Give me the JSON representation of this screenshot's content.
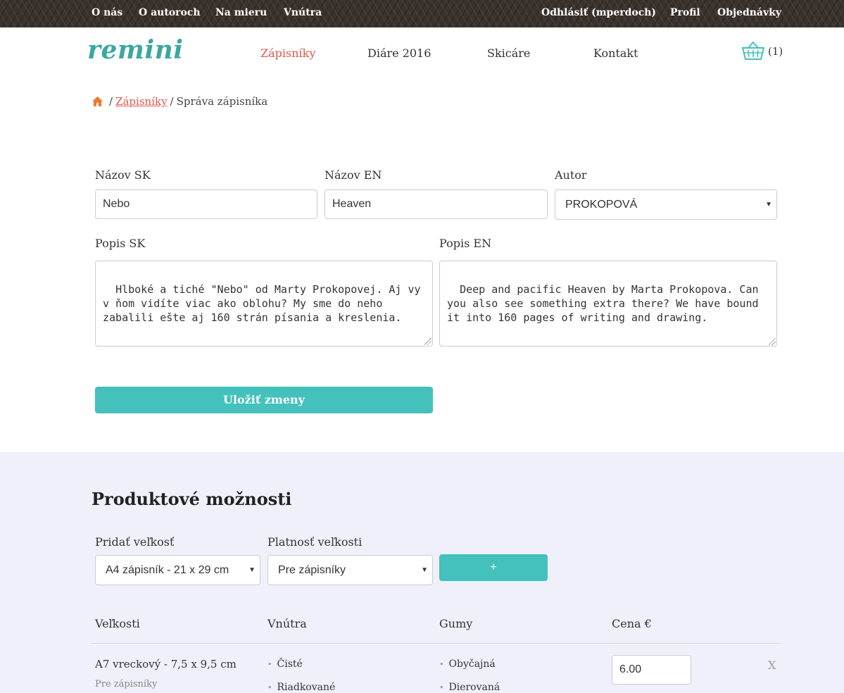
{
  "topbar": {
    "left": [
      "O nás",
      "O autoroch",
      "Na mieru",
      "Vnútra"
    ],
    "right": [
      "Odhlásiť (mperdoch)",
      "Profil",
      "Objednávky"
    ]
  },
  "header": {
    "logo": "remini",
    "nav": [
      "Zápisníky",
      "Diáre 2016",
      "Skicáre",
      "Kontakt"
    ],
    "cart_count": "(1)"
  },
  "breadcrumb": {
    "link": "Zápisníky",
    "separator": "/",
    "current": "Správa zápisníka"
  },
  "form": {
    "name_sk_label": "Názov SK",
    "name_sk_value": "Nebo",
    "name_en_label": "Názov EN",
    "name_en_value": "Heaven",
    "author_label": "Autor",
    "author_value": "PROKOPOVÁ",
    "desc_sk_label": "Popis SK",
    "desc_sk_value": "Hlboké a tiché \"Nebo\" od Marty Prokopovej. Aj vy v ňom vidíte viac ako oblohu? My sme do neho zabalili ešte aj 160 strán písania a kreslenia.",
    "desc_en_label": "Popis EN",
    "desc_en_value": "Deep and pacific Heaven by Marta Prokopova. Can you also see something extra there? We have bound it into 160 pages of writing and drawing.",
    "save_label": "Uložiť zmeny"
  },
  "options": {
    "title": "Produktové možnosti",
    "add_size_label": "Pridať veľkosť",
    "add_size_value": "A4 zápisník - 21 x 29 cm",
    "validity_label": "Platnosť veľkosti",
    "validity_value": "Pre zápisníky",
    "add_button": "+",
    "columns": [
      "Veľkosti",
      "Vnútra",
      "Gumy",
      "Cena €"
    ],
    "rows": [
      {
        "size": "A7 vreckový - 7,5 x 9,5 cm",
        "validity": "Pre zápisníky",
        "insides": [
          "Čisté",
          "Riadkované"
        ],
        "bands": [
          "Obyčajná",
          "Dierovaná"
        ],
        "price": "6.00",
        "delete": "X"
      }
    ]
  },
  "colors": {
    "accent": "#44c1bd",
    "link": "#e0584a",
    "logo": "#3aa8a0",
    "section_bg": "#eff0fa"
  }
}
